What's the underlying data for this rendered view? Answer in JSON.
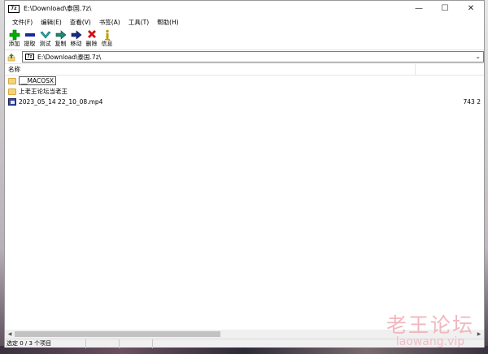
{
  "window": {
    "title": "E:\\Download\\泰国.7z\\",
    "app_icon_text": "7z",
    "controls": {
      "minimize": "—",
      "maximize": "☐",
      "close": "✕"
    }
  },
  "menubar": {
    "items": [
      {
        "label": "文件(F)"
      },
      {
        "label": "编辑(E)"
      },
      {
        "label": "查看(V)"
      },
      {
        "label": "书签(A)"
      },
      {
        "label": "工具(T)"
      },
      {
        "label": "帮助(H)"
      }
    ]
  },
  "toolbar": {
    "items": [
      {
        "label": "添加",
        "icon": "plus-icon",
        "color": "#00a000"
      },
      {
        "label": "提取",
        "icon": "minus-icon",
        "color": "#1a2a9a"
      },
      {
        "label": "测试",
        "icon": "check-icon",
        "color": "#20a0a0"
      },
      {
        "label": "复制",
        "icon": "copy-arrow-icon",
        "color": "#208070"
      },
      {
        "label": "移动",
        "icon": "move-arrow-icon",
        "color": "#1a2a8a"
      },
      {
        "label": "删除",
        "icon": "delete-icon",
        "color": "#d01010"
      },
      {
        "label": "信息",
        "icon": "info-icon",
        "color": "#c0a000"
      }
    ]
  },
  "address": {
    "path": "E:\\Download\\泰国.7z\\",
    "archive_icon_text": "7z"
  },
  "list": {
    "columns": [
      {
        "label": "名称"
      }
    ],
    "rows": [
      {
        "name": "__MACOSX",
        "type": "folder",
        "size": ""
      },
      {
        "name": "上老王论坛当老王",
        "type": "folder",
        "size": ""
      },
      {
        "name": "2023_05_14 22_10_08.mp4",
        "type": "video",
        "size": "743 2"
      }
    ]
  },
  "status": {
    "selection": "选定 0 / 3 个项目"
  },
  "watermark": {
    "cn": "老王论坛",
    "en": "laowang.vip"
  }
}
